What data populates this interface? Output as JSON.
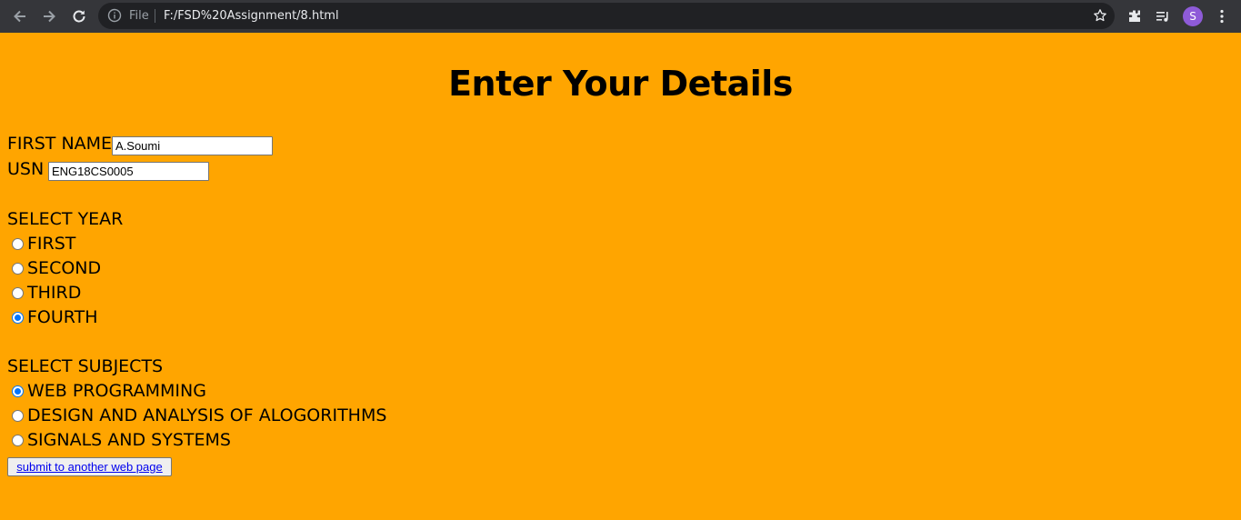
{
  "browser": {
    "file_label": "File",
    "url": "F:/FSD%20Assignment/8.html",
    "avatar_initial": "S"
  },
  "page": {
    "title": "Enter Your Details",
    "first_name": {
      "label": "FIRST NAME",
      "value": "A.Soumi"
    },
    "usn": {
      "label": "USN",
      "value": "ENG18CS0005"
    },
    "year": {
      "heading": "SELECT YEAR",
      "options": [
        {
          "label": "FIRST",
          "checked": false
        },
        {
          "label": "SECOND",
          "checked": false
        },
        {
          "label": "THIRD",
          "checked": false
        },
        {
          "label": "FOURTH",
          "checked": true
        }
      ]
    },
    "subjects": {
      "heading": "SELECT SUBJECTS",
      "options": [
        {
          "label": "WEB PROGRAMMING",
          "checked": true
        },
        {
          "label": "DESIGN AND ANALYSIS OF ALOGORITHMS",
          "checked": false
        },
        {
          "label": "SIGNALS AND SYSTEMS",
          "checked": false
        }
      ]
    },
    "submit_label": "submit to another web page"
  },
  "colors": {
    "page_background": "#FFA500",
    "chrome_background": "#35363A",
    "radio_accent": "#0075FF",
    "link": "#0000EE"
  }
}
